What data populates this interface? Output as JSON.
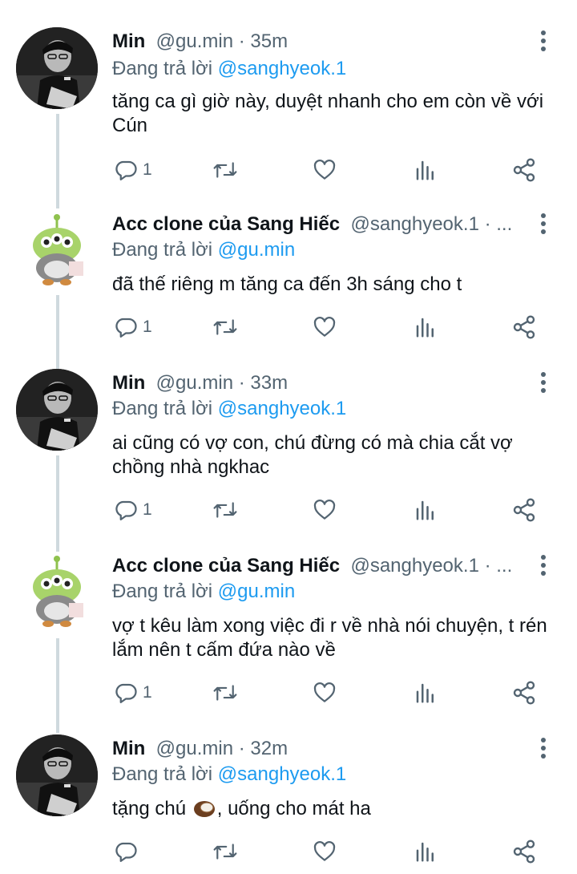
{
  "tweets": [
    {
      "name": "Min",
      "handle": "@gu.min",
      "sep": " · ",
      "time": "35m",
      "replying_prefix": "Đang trả lời ",
      "replying_to": "@sanghyeok.1",
      "text": "tăng ca gì giờ này, duyệt nhanh cho em còn về với Cún",
      "reply_count": "1",
      "avatar": "photo"
    },
    {
      "name": "Acc clone của Sang Hiếc",
      "handle": "@sanghyeok.1",
      "sep": " · ",
      "ellipsis": "...",
      "replying_prefix": "Đang trả lời ",
      "replying_to": "@gu.min",
      "text": "đã thế riêng m tăng ca đến 3h sáng cho t",
      "reply_count": "1",
      "avatar": "alien"
    },
    {
      "name": "Min",
      "handle": "@gu.min",
      "sep": " · ",
      "time": "33m",
      "replying_prefix": "Đang trả lời ",
      "replying_to": "@sanghyeok.1",
      "text": "ai cũng có vợ con, chú đừng có mà chia cắt vợ chồng nhà ngkhac",
      "reply_count": "1",
      "avatar": "photo"
    },
    {
      "name": "Acc clone của Sang Hiếc",
      "handle": "@sanghyeok.1",
      "sep": " · ",
      "ellipsis": "...",
      "replying_prefix": "Đang trả lời ",
      "replying_to": "@gu.min",
      "text": "vợ t kêu làm xong việc đi r về nhà nói chuyện, t rén lắm nên t cấm đứa nào về",
      "reply_count": "1",
      "avatar": "alien"
    },
    {
      "name": "Min",
      "handle": "@gu.min",
      "sep": " · ",
      "time": "32m",
      "replying_prefix": "Đang trả lời ",
      "replying_to": "@sanghyeok.1",
      "text_before": "tặng chú ",
      "text_after": ", uống cho mát ha",
      "reply_count": "",
      "avatar": "photo"
    }
  ],
  "colors": {
    "text": "#0f1419",
    "secondary": "#536471",
    "mention": "#1d9bf0",
    "thread_line": "#cfd9de"
  },
  "icons": {
    "more": "more-vertical-icon",
    "reply": "reply-icon",
    "retweet": "retweet-icon",
    "like": "heart-icon",
    "views": "analytics-icon",
    "share": "share-icon",
    "emoji": "coconut-emoji-icon"
  }
}
